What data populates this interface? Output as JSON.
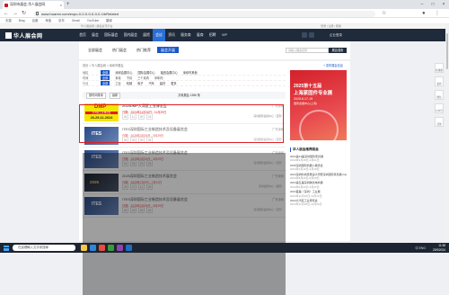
{
  "browser": {
    "tab_title": "深圳市展会-华人展会网",
    "url": "www.huaren.com/expo-0-0-0-0-0-0-0-1/bRelated",
    "new_tab": "+",
    "bookmarks": [
      "天猫",
      "Bing",
      "百度",
      "淘宝",
      "京东",
      "Gmail",
      "YouTube",
      "翻译"
    ]
  },
  "site": {
    "top_left": "华人展会网 | 展会资讯平台",
    "top_right": "登录 | 注册 | 帮助",
    "logo": "华人展会网",
    "nav": [
      "首页",
      "展会",
      "国际展会",
      "国内展会",
      "展馆",
      "会议",
      "资讯",
      "服务商",
      "展商",
      "招聘",
      "VIP",
      "品牌",
      "APP"
    ],
    "nav_active_index": 5,
    "login": "企业登录"
  },
  "subnav": {
    "tabs": [
      "全部展会",
      "热门展会",
      "热门推荐",
      "展会开展"
    ],
    "active_index": 3,
    "search_placeholder": "请输入展会名称",
    "search_button": "展会搜索"
  },
  "breadcrumb": "首页 > 华人展会网 > 深圳市展会",
  "right_link": "+ 发布展会信息",
  "filters": [
    {
      "label": "地区",
      "values": [
        "全部",
        "深圳会展中心",
        "国际会展中心",
        "福田会展中心",
        "深圳市其他"
      ],
      "active": 0
    },
    {
      "label": "时间",
      "values": [
        "全部",
        "本月",
        "下月",
        "三个月内",
        "半年内"
      ],
      "active": 0
    },
    {
      "label": "行业",
      "values": [
        "全部",
        "工业",
        "机械",
        "电子",
        "汽车",
        "建材",
        "更多"
      ],
      "active": 0
    }
  ],
  "sort": {
    "label": "按时间排序",
    "order": "最新",
    "count_text": "共有展会 1386 条"
  },
  "items": [
    {
      "title": "2024DMP大湾区工业博览会",
      "date": "日期：2024年11月26日 - 11月29日",
      "loc": "广东深圳",
      "venue": "深圳国际会展中心（宝安）",
      "counts": [
        "26",
        "11",
        "29",
        "24"
      ],
      "thumb": "dmp"
    },
    {
      "title": "ITES深圳国际工业制造技术及设备展览会",
      "date": "日期：2025年3月26日 - 3月29日",
      "loc": "广东深圳",
      "venue": "深圳国际会展中心（宝安）",
      "counts": [
        "26",
        "03",
        "29",
        "25"
      ],
      "thumb": "itx"
    },
    {
      "title": "ITES深圳国际工业制造技术及设备展览会",
      "date": "日期：2025年3月26日 - 3月29日",
      "loc": "广东深圳",
      "venue": "深圳国际会展中心（宝安）",
      "counts": [
        "26",
        "03",
        "29",
        "25"
      ],
      "thumb": "itx"
    },
    {
      "title": "2025深圳国际工业制造技术展览会",
      "date": "日期：2025年7月9日 - 7月11日",
      "loc": "广东深圳",
      "venue": "深圳会展中心（福田）",
      "counts": [
        "09",
        "07",
        "11",
        "25"
      ],
      "thumb": "dk"
    },
    {
      "title": "ITES深圳国际工业制造技术及设备展览会",
      "date": "日期：2025年3月26日 - 3月29日",
      "loc": "广东深圳",
      "venue": "深圳国际会展中心（宝安）",
      "counts": [
        "26",
        "03",
        "29",
        "25"
      ],
      "thumb": "itx"
    }
  ],
  "ad": {
    "line1": "2025第十五届",
    "line2": "上海紧固件专业展",
    "line3": "2025.6.17-19",
    "line4": "国家会展中心(上海)"
  },
  "right": {
    "head": "华人展会推荐展会",
    "items": [
      {
        "t": "2024第14届深圳国际家具展",
        "d": "2024年3月18日-3月21日"
      },
      {
        "t": "2025深圳国际机器人展览会",
        "d": "2024年4月16日-4月18日"
      },
      {
        "t": "2024深圳时尚家居设计周暨深圳国际家具展 Fashion Design",
        "d": "2024年8月26日-8月28日"
      },
      {
        "t": "2024第五届深圳跨境电商展",
        "d": "2024年9月20日-9月22日"
      },
      {
        "t": "2024首届（深圳）工业展",
        "d": "2024年11月10日-11月12日"
      },
      {
        "t": "2024大湾区工业博览会",
        "d": "2024年11月26日-11月29日"
      }
    ]
  },
  "side_tools": [
    "在线客服",
    "发布",
    "微信",
    "公众号",
    "顶部"
  ],
  "taskbar": {
    "search": "在這裡輸入文字來搜尋",
    "time": "11:38",
    "date": "23/9/2024",
    "lang": "中 ENG"
  }
}
